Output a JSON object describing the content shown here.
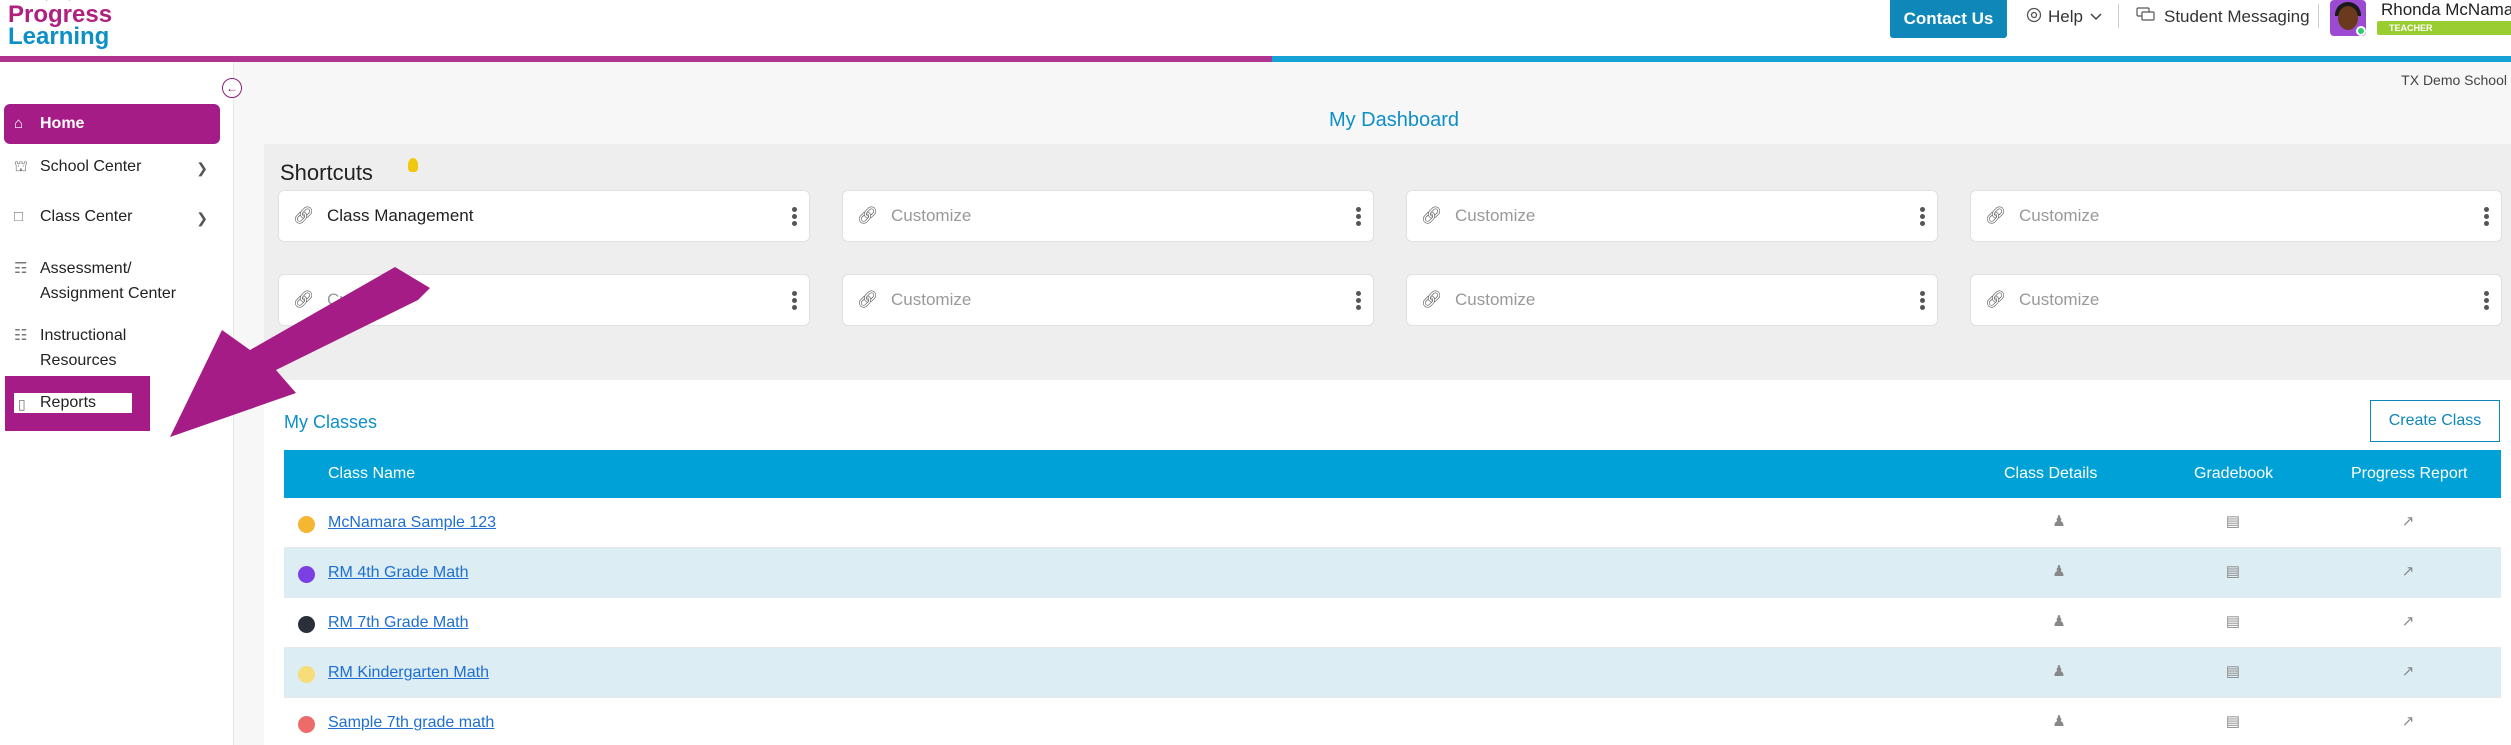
{
  "header": {
    "logo_line1": "Progress",
    "logo_line2": "Learning",
    "contact_label": "Contact Us",
    "help_label": "Help",
    "messaging_label": "Student Messaging",
    "user_name": "Rhonda McNamara",
    "user_role": "TEACHER"
  },
  "sidebar": {
    "items": [
      {
        "label": "Home",
        "icon": "home-icon"
      },
      {
        "label": "School Center",
        "icon": "school-icon"
      },
      {
        "label": "Class Center",
        "icon": "class-icon"
      },
      {
        "label": "Assessment/",
        "label2": "Assignment Center",
        "icon": "book-icon"
      },
      {
        "label": "Instructional",
        "label2": "Resources",
        "icon": "library-icon"
      },
      {
        "label": "Reports",
        "icon": "report-icon"
      }
    ]
  },
  "main": {
    "school_name": "TX Demo School",
    "title": "My Dashboard",
    "shortcuts_title": "Shortcuts",
    "shortcuts": [
      "Class Management",
      "Customize",
      "Customize",
      "Customize",
      "Customize",
      "Customize",
      "Customize",
      "Customize"
    ],
    "classes_title": "My Classes",
    "create_class_label": "Create Class",
    "table_headers": {
      "name": "Class Name",
      "details": "Class Details",
      "gradebook": "Gradebook",
      "progress": "Progress Report"
    },
    "classes": [
      {
        "name": "McNamara Sample 123",
        "color": "#f5b731"
      },
      {
        "name": "RM 4th Grade Math",
        "color": "#7b3fe4"
      },
      {
        "name": "RM 7th Grade Math",
        "color": "#2b2f3a"
      },
      {
        "name": "RM Kindergarten Math",
        "color": "#f7dc7a"
      },
      {
        "name": "Sample 7th grade math",
        "color": "#ee6b6b"
      }
    ]
  },
  "colors": {
    "brand_magenta": "#a51c86",
    "brand_blue": "#00a1d6"
  }
}
